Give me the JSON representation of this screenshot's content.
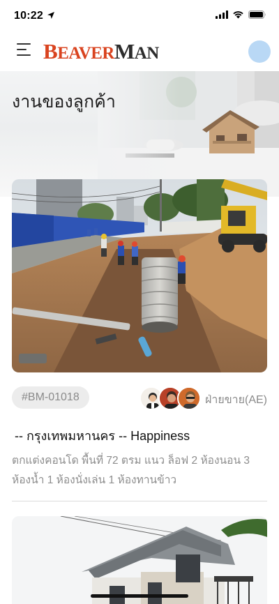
{
  "status_bar": {
    "time": "10:22",
    "icons": [
      "location-arrow-icon",
      "cellular-signal-icon",
      "wifi-icon",
      "battery-icon"
    ]
  },
  "header": {
    "menu_icon": "hamburger-menu-icon",
    "logo_parts": [
      "B",
      "EAVER",
      "M",
      "AN"
    ],
    "avatar_color": "#b9d8f5"
  },
  "banner": {
    "title": "งานของลูกค้า"
  },
  "jobs": [
    {
      "tag": "#BM-01018",
      "role": "ฝ่ายขาย(AE)",
      "title": " -- กรุงเทพมหานคร -- Happiness",
      "description": "ตกแต่งคอนโด พื้นที่ 72 ตรม แนว ล็อฟ 2 ห้องนอน 3 ห้องน้ำ 1 ห้องนั่งเล่น 1 ห้องทานข้าว",
      "team_avatars": [
        "avatar-1",
        "avatar-2",
        "avatar-3"
      ]
    }
  ],
  "colors": {
    "brand_red": "#d9431f",
    "brand_dark": "#2c2c2c",
    "tag_bg": "#ececec",
    "muted_text": "#8d8d8d"
  }
}
